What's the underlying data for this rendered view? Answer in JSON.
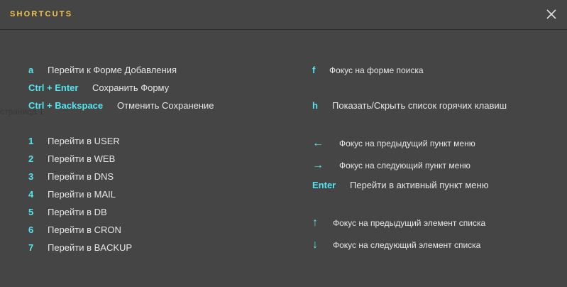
{
  "header": {
    "title": "SHORTCUTS",
    "close_icon": "close-icon"
  },
  "background_fragment": "страница 1",
  "colors": {
    "background": "#454545",
    "title": "#f2c94c",
    "key": "#52e6f0",
    "text": "#e6e6e6"
  },
  "left_column": [
    {
      "key": "a",
      "desc": "Перейти к Форме Добавления"
    },
    {
      "key": "Ctrl + Enter",
      "desc": "Сохранить Форму"
    },
    {
      "key": "Ctrl + Backspace",
      "desc": "Отменить Сохранение"
    },
    {
      "key": "1",
      "desc": "Перейти в USER"
    },
    {
      "key": "2",
      "desc": "Перейти в WEB"
    },
    {
      "key": "3",
      "desc": "Перейти в DNS"
    },
    {
      "key": "4",
      "desc": "Перейти в MAIL"
    },
    {
      "key": "5",
      "desc": "Перейти в DB"
    },
    {
      "key": "6",
      "desc": "Перейти в CRON"
    },
    {
      "key": "7",
      "desc": "Перейти в BACKUP"
    }
  ],
  "right_column": [
    {
      "key": "f",
      "desc": "Фокус на форме поиска"
    },
    {
      "key": "h",
      "desc": "Показать/Скрыть список горячих клавиш"
    },
    {
      "key": "←",
      "desc": "Фокус на предыдущий пункт меню"
    },
    {
      "key": "→",
      "desc": "Фокус на следующий пункт меню"
    },
    {
      "key": "Enter",
      "desc": "Перейти в активный пункт меню"
    },
    {
      "key": "↑",
      "desc": "Фокус на предыдущий элемент списка"
    },
    {
      "key": "↓",
      "desc": "Фокус на следующий элемент списка"
    }
  ]
}
